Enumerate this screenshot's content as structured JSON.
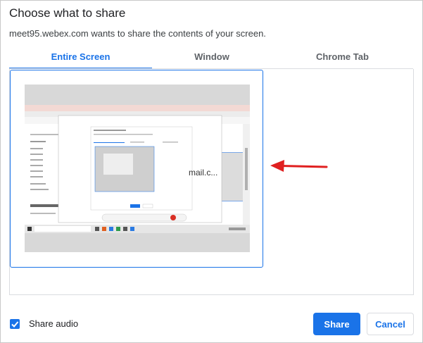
{
  "dialog": {
    "title": "Choose what to share",
    "subtitle": "meet95.webex.com wants to share the contents of your screen."
  },
  "tabs": [
    {
      "label": "Entire Screen",
      "active": true
    },
    {
      "label": "Window",
      "active": false
    },
    {
      "label": "Chrome Tab",
      "active": false
    }
  ],
  "footer": {
    "share_audio_label": "Share audio",
    "share_audio_checked": true,
    "share_label": "Share",
    "cancel_label": "Cancel"
  },
  "colors": {
    "accent": "#1a73e8",
    "arrow": "#e02020"
  },
  "thumbnail": {
    "visible_text": "mail.c..."
  }
}
